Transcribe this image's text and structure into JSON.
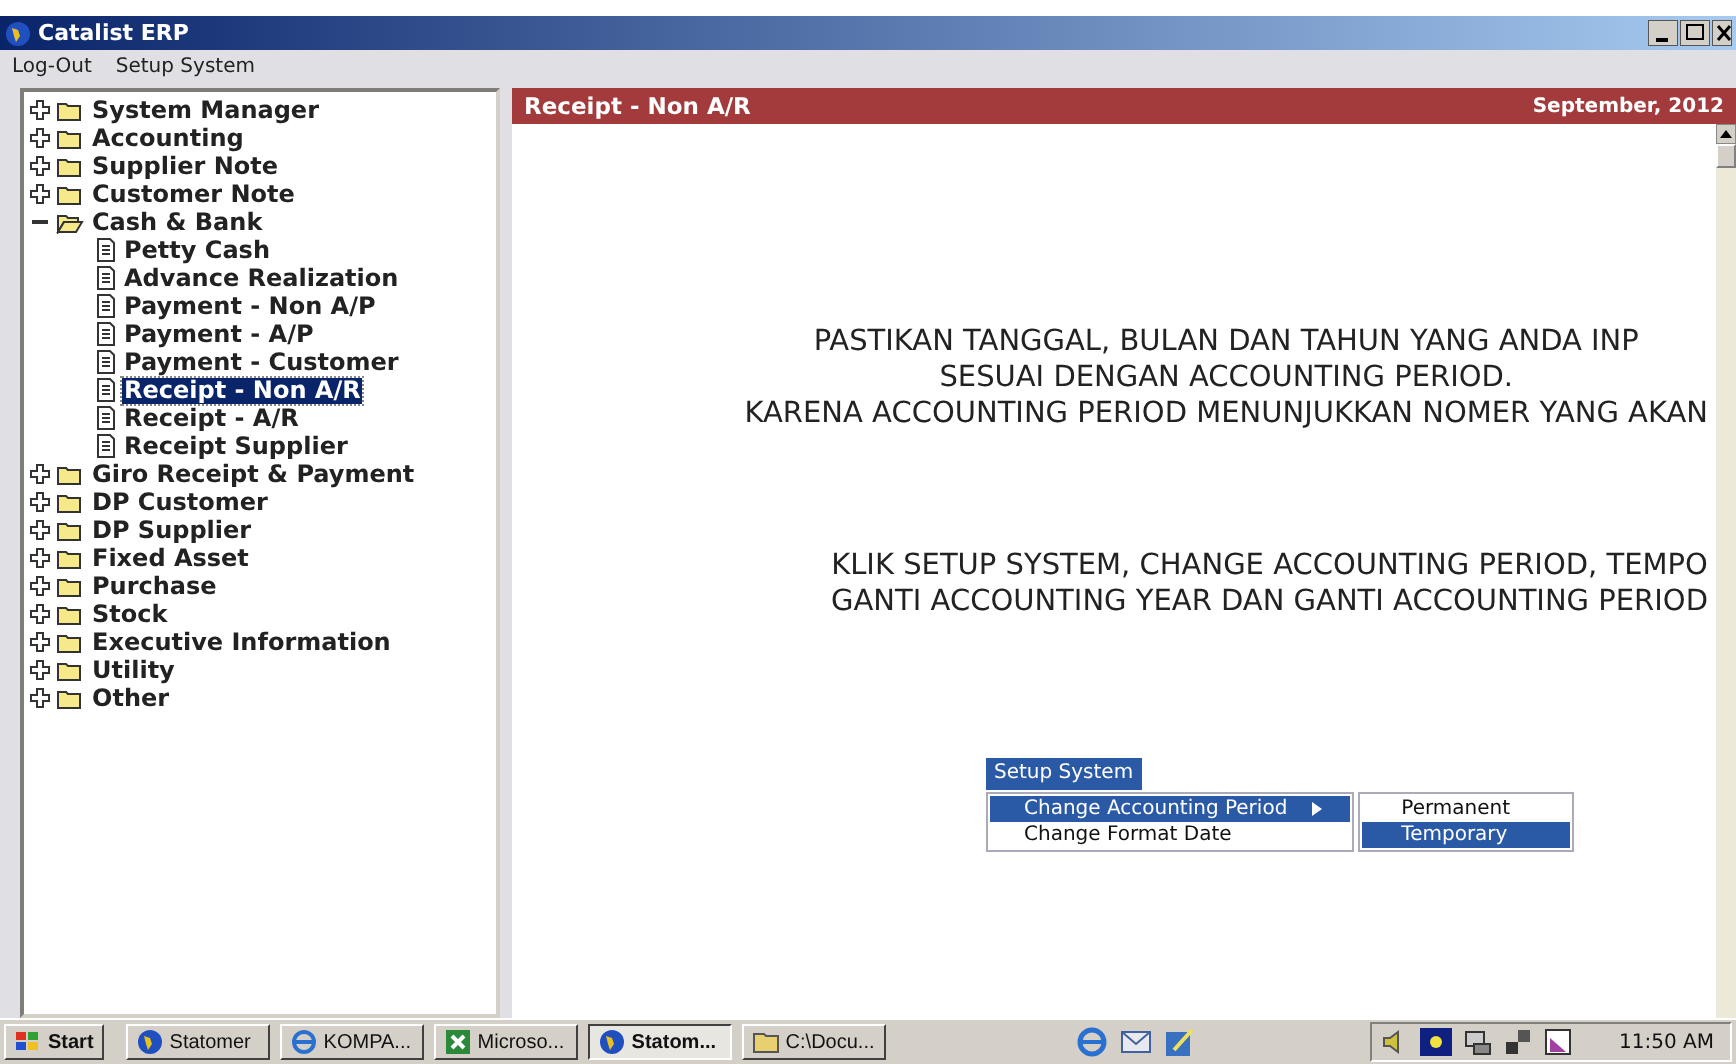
{
  "window": {
    "title": "Catalist ERP"
  },
  "menu_bar": [
    "Log-Out",
    "Setup System"
  ],
  "tree": [
    {
      "label": "System Manager",
      "expanded": false
    },
    {
      "label": "Accounting",
      "expanded": false
    },
    {
      "label": "Supplier Note",
      "expanded": false
    },
    {
      "label": "Customer Note",
      "expanded": false
    },
    {
      "label": "Cash & Bank",
      "expanded": true,
      "children": [
        {
          "label": "Petty Cash",
          "selected": false
        },
        {
          "label": "Advance Realization",
          "selected": false
        },
        {
          "label": "Payment - Non A/P",
          "selected": false
        },
        {
          "label": "Payment - A/P",
          "selected": false
        },
        {
          "label": "Payment - Customer",
          "selected": false
        },
        {
          "label": "Receipt - Non A/R",
          "selected": true
        },
        {
          "label": "Receipt - A/R",
          "selected": false
        },
        {
          "label": "Receipt Supplier",
          "selected": false
        }
      ]
    },
    {
      "label": "Giro Receipt & Payment",
      "expanded": false
    },
    {
      "label": "DP Customer",
      "expanded": false
    },
    {
      "label": "DP Supplier",
      "expanded": false
    },
    {
      "label": "Fixed Asset",
      "expanded": false
    },
    {
      "label": "Purchase",
      "expanded": false
    },
    {
      "label": "Stock",
      "expanded": false
    },
    {
      "label": "Executive Information",
      "expanded": false
    },
    {
      "label": "Utility",
      "expanded": false
    },
    {
      "label": "Other",
      "expanded": false
    }
  ],
  "panel": {
    "title": "Receipt - Non A/R",
    "period": "September, 2012",
    "message": [
      [
        "PASTIKAN TANGGAL, BULAN DAN TAHUN YANG ANDA INP",
        "SESUAI DENGAN ACCOUNTING PERIOD.",
        "KARENA ACCOUNTING PERIOD MENUNJUKKAN NOMER YANG AKAN"
      ],
      [
        "KLIK SETUP SYSTEM, CHANGE ACCOUNTING PERIOD, TEMPO",
        "GANTI ACCOUNTING YEAR DAN GANTI ACCOUNTING PERIOD"
      ]
    ]
  },
  "popup_menu": {
    "title": "Setup System",
    "items": [
      {
        "label": "Change Accounting Period",
        "selected": true,
        "submenu": true
      },
      {
        "label": "Change Format Date",
        "selected": false,
        "submenu": false
      }
    ],
    "submenu": [
      {
        "label": "Permanent",
        "selected": false
      },
      {
        "label": "Temporary",
        "selected": true
      }
    ]
  },
  "taskbar": {
    "start": "Start",
    "buttons": [
      {
        "label": "Statomer",
        "pressed": false,
        "kind": "globe"
      },
      {
        "label": "KOMPA...",
        "pressed": false,
        "kind": "browser"
      },
      {
        "label": "Microso...",
        "pressed": false,
        "kind": "sheet"
      },
      {
        "label": "Statom...",
        "pressed": true,
        "kind": "globe"
      },
      {
        "label": "C:\\Docu...",
        "pressed": false,
        "kind": "folder"
      }
    ],
    "clock": "11:50 AM"
  }
}
